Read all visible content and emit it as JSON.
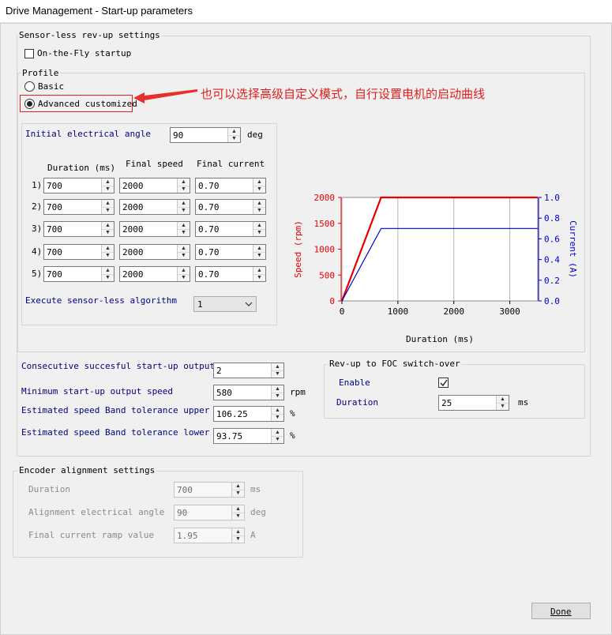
{
  "window": {
    "title": "Drive Management - Start-up parameters"
  },
  "sensorless": {
    "group_label": "Sensor-less rev-up settings",
    "on_the_fly_label": "On-the-Fly startup",
    "profile_label": "Profile",
    "basic_label": "Basic",
    "advanced_label": "Advanced customized",
    "annotation": "也可以选择高级自定义模式，自行设置电机的启动曲线",
    "initial_angle_label": "Initial electrical angle",
    "initial_angle_value": "90",
    "initial_angle_unit": "deg",
    "col_duration": "Duration (ms)",
    "col_speed": "Final speed",
    "col_current": "Final current",
    "rows": [
      {
        "idx": "1)",
        "duration": "700",
        "speed": "2000",
        "current": "0.70"
      },
      {
        "idx": "2)",
        "duration": "700",
        "speed": "2000",
        "current": "0.70"
      },
      {
        "idx": "3)",
        "duration": "700",
        "speed": "2000",
        "current": "0.70"
      },
      {
        "idx": "4)",
        "duration": "700",
        "speed": "2000",
        "current": "0.70"
      },
      {
        "idx": "5)",
        "duration": "700",
        "speed": "2000",
        "current": "0.70"
      }
    ],
    "execute_label": "Execute sensor-less algorithm",
    "execute_value": "1"
  },
  "chart_data": {
    "type": "line",
    "xlabel": "Duration (ms)",
    "ylabel": "Speed (rpm)",
    "y2label": "Current (A)",
    "xlim": [
      0,
      3500
    ],
    "ylim": [
      0,
      2000
    ],
    "y2lim": [
      0,
      1.0
    ],
    "xticks": [
      "0",
      "1000",
      "2000",
      "3000"
    ],
    "yticks": [
      "0",
      "500",
      "1000",
      "1500",
      "2000"
    ],
    "y2ticks": [
      "0.0",
      "0.2",
      "0.4",
      "0.6",
      "0.8",
      "1.0"
    ],
    "grid": true,
    "speed_color": "#e60000",
    "current_color": "#0000cc",
    "series": [
      {
        "name": "Speed (rpm)",
        "axis": "left",
        "x": [
          0,
          700,
          3500
        ],
        "y": [
          0,
          2000,
          2000
        ]
      },
      {
        "name": "Current (A)",
        "axis": "right",
        "x": [
          0,
          700,
          3500
        ],
        "y": [
          0,
          0.7,
          0.7
        ]
      }
    ]
  },
  "output": {
    "consecutive_label": "Consecutive succesful start-up output",
    "consecutive_value": "2",
    "min_speed_label": "Minimum start-up output speed",
    "min_speed_value": "580",
    "min_speed_unit": "rpm",
    "upper_label": "Estimated speed Band tolerance upper",
    "upper_value": "106.25",
    "upper_unit": "%",
    "lower_label": "Estimated speed Band tolerance lower",
    "lower_value": "93.75",
    "lower_unit": "%"
  },
  "foc": {
    "group_label": "Rev-up to FOC switch-over",
    "enable_label": "Enable",
    "duration_label": "Duration",
    "duration_value": "25",
    "duration_unit": "ms"
  },
  "encoder": {
    "group_label": "Encoder alignment settings",
    "duration_label": "Duration",
    "duration_value": "700",
    "duration_unit": "ms",
    "angle_label": "Alignment electrical angle",
    "angle_value": "90",
    "angle_unit": "deg",
    "ramp_label": "Final current ramp value",
    "ramp_value": "1.95",
    "ramp_unit": "A"
  },
  "footer": {
    "done_label": "Done"
  }
}
